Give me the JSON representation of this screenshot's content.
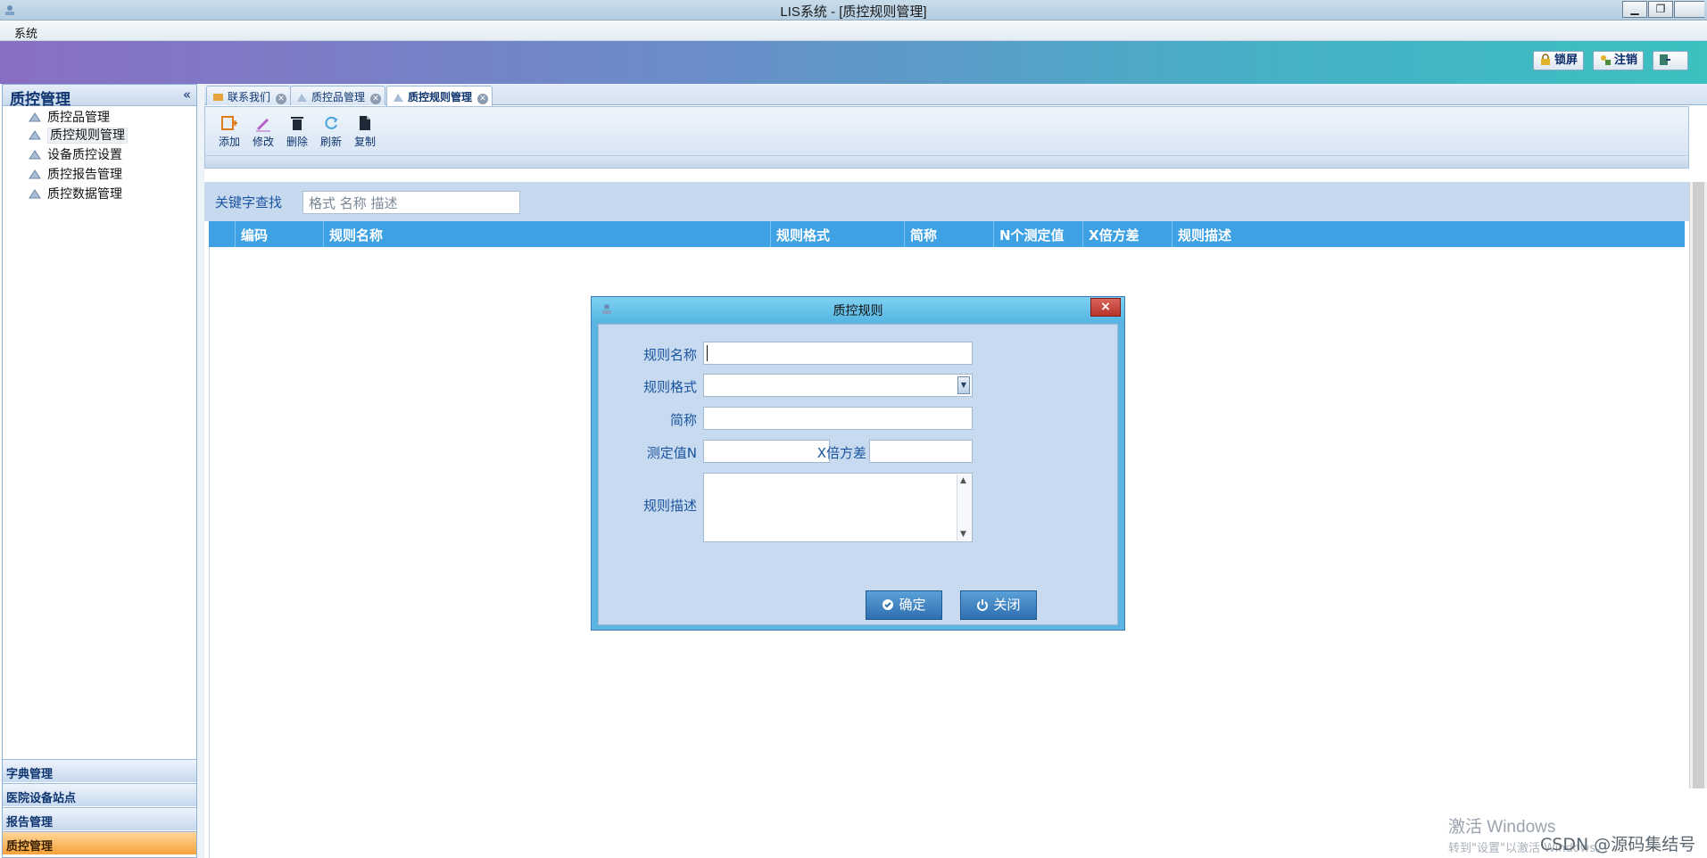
{
  "window": {
    "title": "LIS系统 - [质控规则管理]"
  },
  "menu": {
    "system": "系统"
  },
  "banner": {
    "lock": "锁屏",
    "logout": "注销",
    "exit": "退"
  },
  "left_panel": {
    "title": "质控管理",
    "collapse": "«",
    "items": [
      {
        "label": "质控品管理"
      },
      {
        "label": "质控规则管理"
      },
      {
        "label": "设备质控设置"
      },
      {
        "label": "质控报告管理"
      },
      {
        "label": "质控数据管理"
      }
    ],
    "sections": [
      {
        "label": "字典管理"
      },
      {
        "label": "医院设备站点"
      },
      {
        "label": "报告管理"
      },
      {
        "label": "质控管理"
      }
    ]
  },
  "tabs": [
    {
      "label": "联系我们"
    },
    {
      "label": "质控品管理"
    },
    {
      "label": "质控规则管理"
    }
  ],
  "toolbar": {
    "add": "添加",
    "edit": "修改",
    "delete": "删除",
    "refresh": "刷新",
    "copy": "复制"
  },
  "search": {
    "label": "关键字查找",
    "placeholder": "格式  名称  描述"
  },
  "grid": {
    "columns": [
      "编码",
      "规则名称",
      "规则格式",
      "简称",
      "N个测定值",
      "X倍方差",
      "规则描述"
    ]
  },
  "dialog": {
    "title": "质控规则",
    "close": "×",
    "fields": {
      "rule_name": "规则名称",
      "rule_format": "规则格式",
      "short_name": "简称",
      "measure_n": "测定值N",
      "x_variance": "X倍方差",
      "rule_desc": "规则描述"
    },
    "ok": "确定",
    "cancel": "关闭"
  },
  "watermark": {
    "line1": "激活 Windows",
    "line2": "转到\"设置\"以激活 Windows。",
    "csdn": "CSDN @源码集结号"
  }
}
